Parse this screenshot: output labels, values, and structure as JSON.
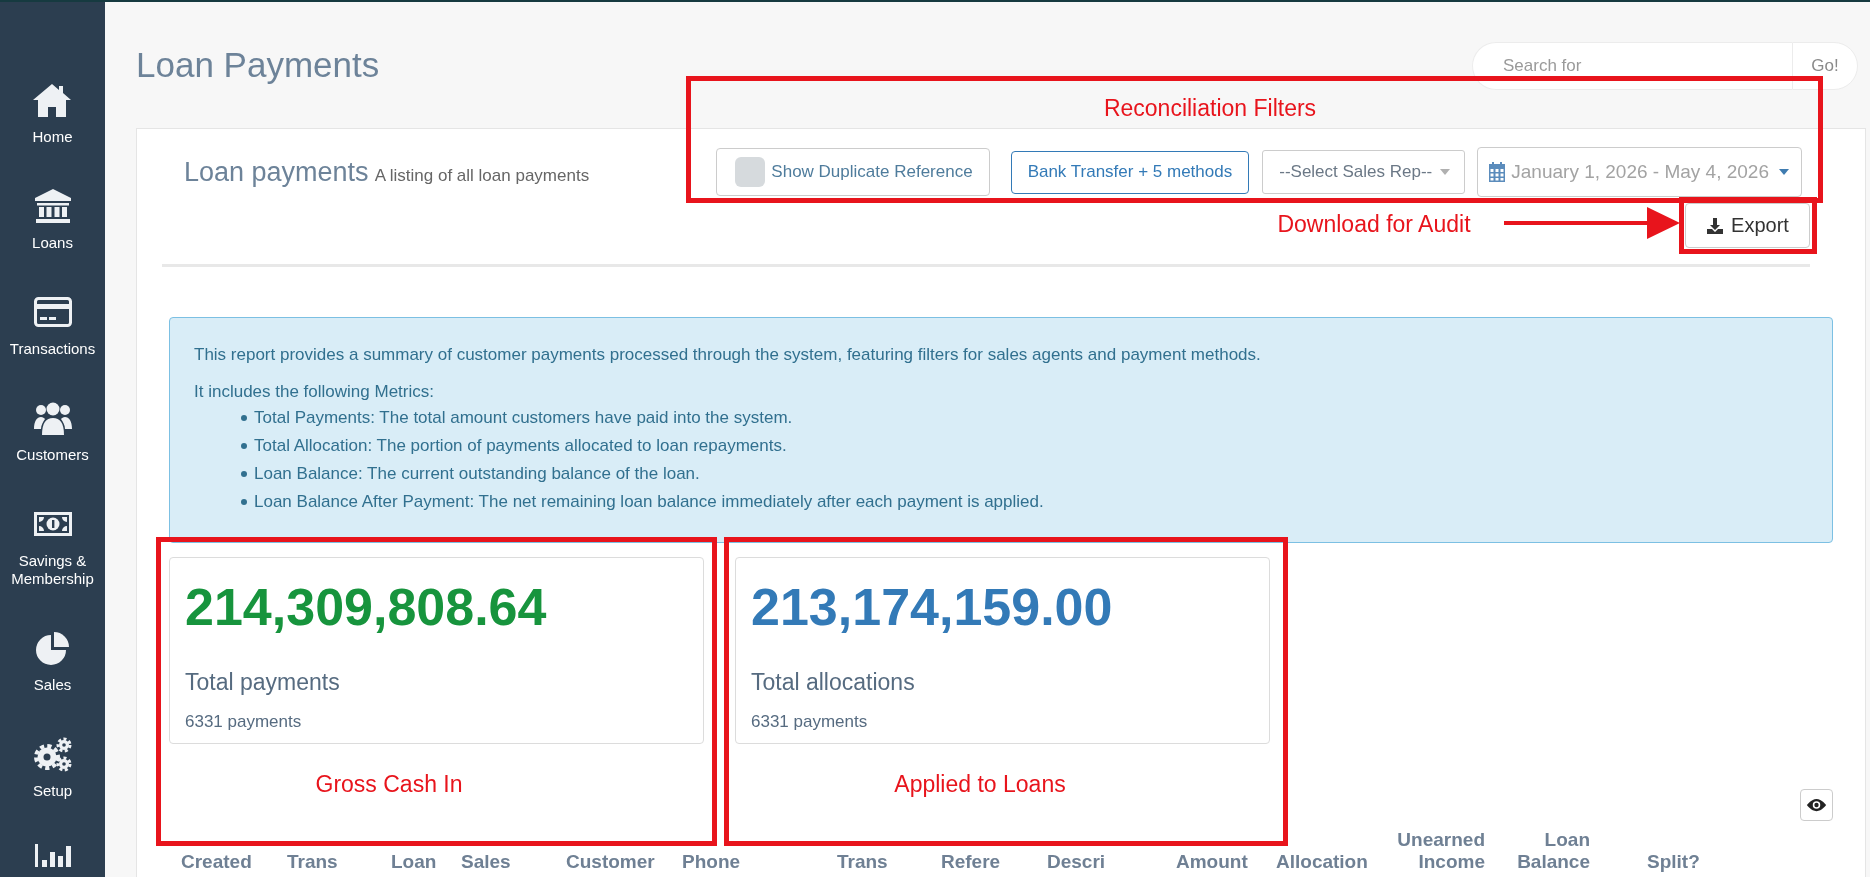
{
  "sidebar": {
    "items": [
      {
        "label": "Home",
        "selected": false
      },
      {
        "label": "Loans",
        "selected": false
      },
      {
        "label": "Transactions",
        "selected": false
      },
      {
        "label": "Customers",
        "selected": false
      },
      {
        "label": "Savings & Membership",
        "selected": false
      },
      {
        "label": "Sales",
        "selected": false
      },
      {
        "label": "Setup",
        "selected": false
      }
    ],
    "more_below": true
  },
  "page": {
    "title": "Loan Payments"
  },
  "search": {
    "placeholder": "Search for",
    "button": "Go!"
  },
  "panel": {
    "title": "Loan payments",
    "subtitle": "A listing of all loan payments",
    "filters": {
      "duplicate_reference": {
        "label": "Show Duplicate Reference",
        "checked": false
      },
      "payment_methods": "Bank Transfer + 5 methods",
      "sales_rep": "--Select Sales Rep--",
      "date_range": "January 1, 2026 - May 4, 2026"
    },
    "export_button": "Export",
    "info": {
      "intro": "This report provides a summary of customer payments processed through the system, featuring filters for sales agents and payment methods.",
      "lead": "It includes the following Metrics:",
      "items": [
        "Total Payments: The total amount customers have paid into the system.",
        "Total Allocation: The portion of payments allocated to loan repayments.",
        "Loan Balance: The current outstanding balance of the loan.",
        "Loan Balance After Payment: The net remaining loan balance immediately after each payment is applied."
      ]
    },
    "metrics": [
      {
        "value": "214,309,808.64",
        "label": "Total payments",
        "count": "6331 payments",
        "color": "#17943d"
      },
      {
        "value": "213,174,159.00",
        "label": "Total allocations",
        "count": "6331 payments",
        "color": "#337ab7"
      }
    ],
    "table": {
      "columns": [
        "Created",
        "Trans",
        "Loan",
        "Sales",
        "Customer",
        "Phone",
        "Trans",
        "Refere",
        "Descri",
        "Amount",
        "Allocation",
        "Unearned Income",
        "Loan Balance",
        "Split?"
      ]
    }
  },
  "annotations": [
    {
      "kind": "frame",
      "label": "Reconciliation Filters"
    },
    {
      "kind": "arrow",
      "label": "Download for Audit"
    },
    {
      "kind": "frame"
    },
    {
      "kind": "frame",
      "label": "Gross Cash In"
    },
    {
      "kind": "frame",
      "label": "Applied to Loans"
    }
  ]
}
